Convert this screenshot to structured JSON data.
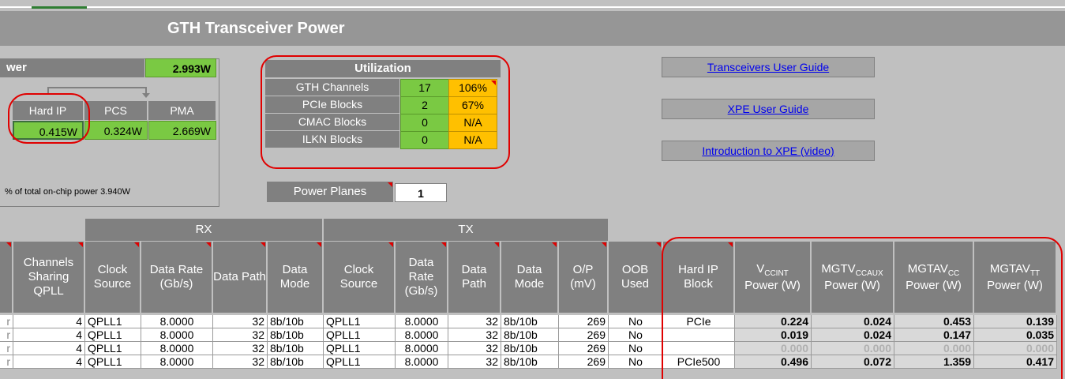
{
  "banner": {
    "title": "GTH Transceiver Power"
  },
  "power_summary": {
    "label": "wer",
    "total": "2.993W",
    "columns": [
      "Hard IP",
      "PCS",
      "PMA"
    ],
    "values": [
      "0.415W",
      "0.324W",
      "2.669W"
    ],
    "note": "% of total on-chip power 3.940W"
  },
  "utilization": {
    "title": "Utilization",
    "rows": [
      {
        "label": "GTH Channels",
        "count": "17",
        "pct": "106%"
      },
      {
        "label": "PCIe Blocks",
        "count": "2",
        "pct": "67%"
      },
      {
        "label": "CMAC Blocks",
        "count": "0",
        "pct": "N/A"
      },
      {
        "label": "ILKN Blocks",
        "count": "0",
        "pct": "N/A"
      }
    ]
  },
  "power_planes": {
    "label": "Power Planes",
    "value": "1"
  },
  "links": [
    "Transceivers User Guide",
    "XPE User Guide",
    "Introduction to XPE (video)"
  ],
  "table": {
    "groups": {
      "rx": "RX",
      "tx": "TX"
    },
    "headers": {
      "sharing": "Channels Sharing QPLL",
      "rx_clock": "Clock Source",
      "rx_rate": "Data Rate (Gb/s)",
      "rx_path": "Data Path",
      "rx_mode": "Data Mode",
      "tx_clock": "Clock Source",
      "tx_rate": "Data Rate (Gb/s)",
      "tx_path": "Data Path",
      "tx_mode": "Data Mode",
      "op": "O/P (mV)",
      "oob": "OOB Used",
      "hardip": "Hard IP Block",
      "vccint_main": "V",
      "vccint_sub": "CCINT",
      "vccint_unit": "Power (W)",
      "mgtvccaux_main": "MGTV",
      "mgtvccaux_sub": "CCAUX",
      "mgtvccaux_unit": "Power (W)",
      "mgtavcc_main": "MGTAV",
      "mgtavcc_sub": "CC",
      "mgtavcc_unit": "Power (W)",
      "mgtavtt_main": "MGTAV",
      "mgtavtt_sub": "TT",
      "mgtavtt_unit": "Power (W)"
    },
    "rows": [
      {
        "stub": "r",
        "sharing": "4",
        "rx_clock": "QPLL1",
        "rx_rate": "8.0000",
        "rx_path": "32",
        "rx_mode": "8b/10b",
        "tx_clock": "QPLL1",
        "tx_rate": "8.0000",
        "tx_path": "32",
        "tx_mode": "8b/10b",
        "op": "269",
        "oob": "No",
        "hardip": "PCIe",
        "vccint": "0.224",
        "mgtvccaux": "0.024",
        "mgtavcc": "0.453",
        "mgtavtt": "0.139"
      },
      {
        "stub": "r",
        "sharing": "4",
        "rx_clock": "QPLL1",
        "rx_rate": "8.0000",
        "rx_path": "32",
        "rx_mode": "8b/10b",
        "tx_clock": "QPLL1",
        "tx_rate": "8.0000",
        "tx_path": "32",
        "tx_mode": "8b/10b",
        "op": "269",
        "oob": "No",
        "hardip": "",
        "vccint": "0.019",
        "mgtvccaux": "0.024",
        "mgtavcc": "0.147",
        "mgtavtt": "0.035"
      },
      {
        "stub": "r",
        "sharing": "4",
        "rx_clock": "QPLL1",
        "rx_rate": "8.0000",
        "rx_path": "32",
        "rx_mode": "8b/10b",
        "tx_clock": "QPLL1",
        "tx_rate": "8.0000",
        "tx_path": "32",
        "tx_mode": "8b/10b",
        "op": "269",
        "oob": "No",
        "hardip": "",
        "vccint": "0.000",
        "mgtvccaux": "0.000",
        "mgtavcc": "0.000",
        "mgtavtt": "0.000"
      },
      {
        "stub": "r",
        "sharing": "4",
        "rx_clock": "QPLL1",
        "rx_rate": "8.0000",
        "rx_path": "32",
        "rx_mode": "8b/10b",
        "tx_clock": "QPLL1",
        "tx_rate": "8.0000",
        "tx_path": "32",
        "tx_mode": "8b/10b",
        "op": "269",
        "oob": "No",
        "hardip": "PCIe500",
        "vccint": "0.496",
        "mgtvccaux": "0.072",
        "mgtavcc": "1.359",
        "mgtavtt": "0.417"
      }
    ]
  }
}
